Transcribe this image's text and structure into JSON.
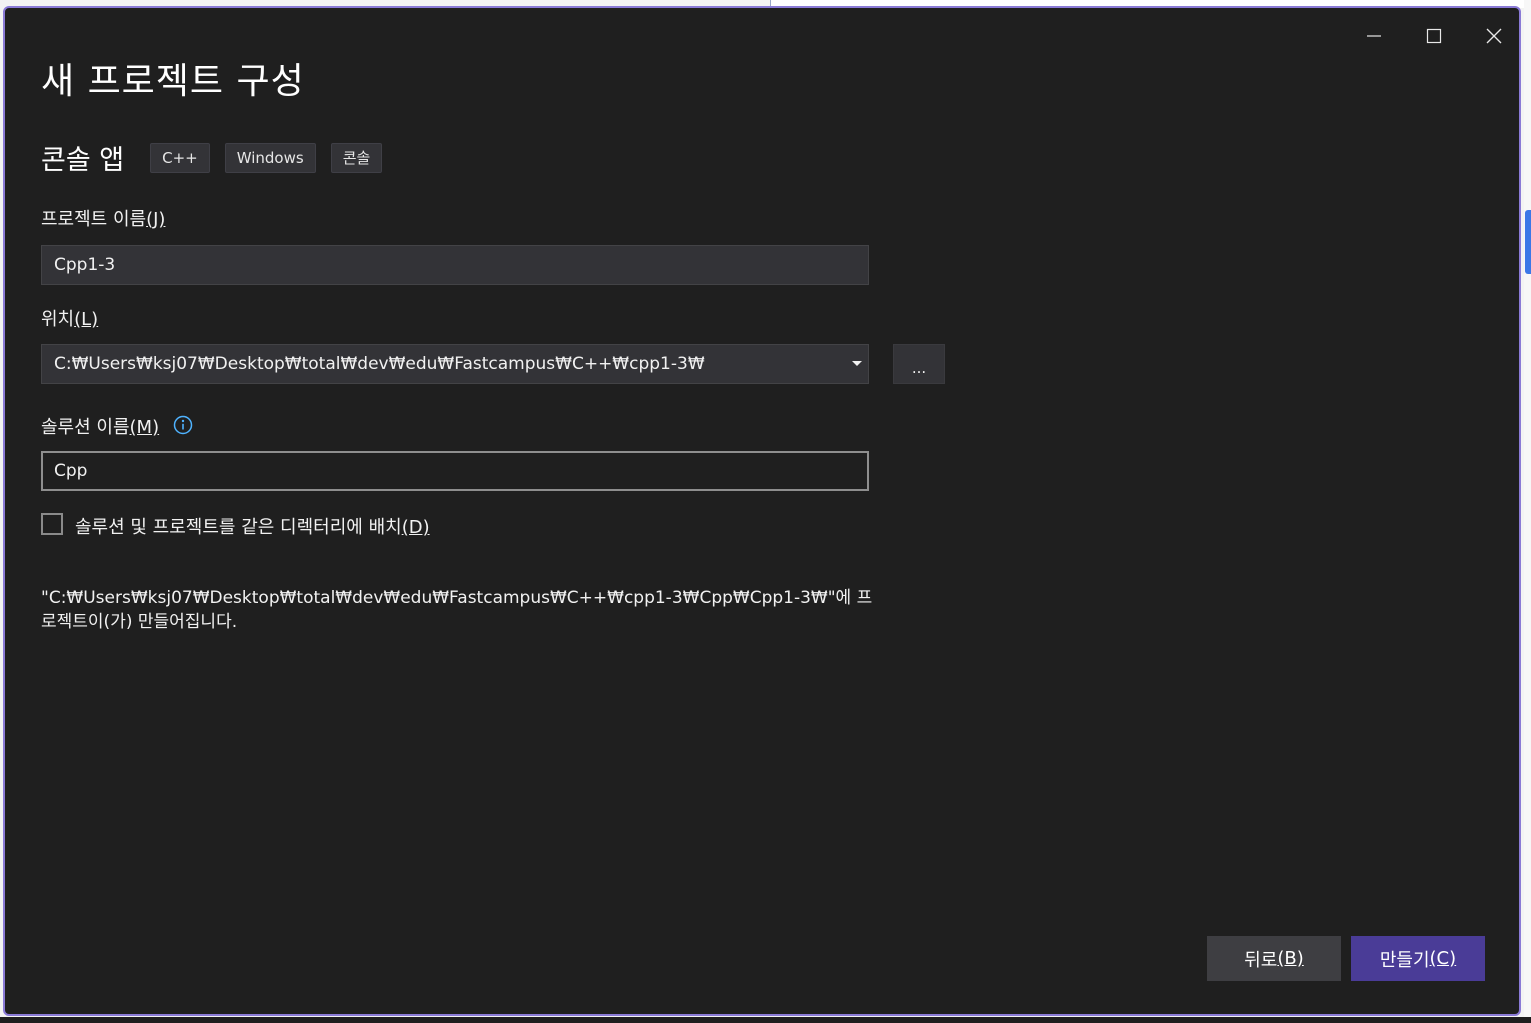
{
  "window": {
    "title": "새 프로젝트 구성",
    "controls": [
      "minimize",
      "maximize",
      "close"
    ]
  },
  "template": {
    "name": "콘솔 앱",
    "tags": [
      "C++",
      "Windows",
      "콘솔"
    ]
  },
  "form": {
    "project_name_label": "프로젝트 이름",
    "project_name_key": "(J)",
    "project_name_value": "Cpp1-3",
    "location_label": "위치",
    "location_key": "(L)",
    "location_value": "C:₩Users₩ksj07₩Desktop₩total₩dev₩edu₩Fastcampus₩C++₩cpp1-3₩",
    "browse_label": "...",
    "solution_name_label": "솔루션 이름",
    "solution_name_key": "(M)",
    "solution_name_value": "Cpp",
    "same_dir_label": "솔루션 및 프로젝트를 같은 디렉터리에 배치",
    "same_dir_key": "(D)",
    "same_dir_checked": false,
    "path_info": "\"C:₩Users₩ksj07₩Desktop₩total₩dev₩edu₩Fastcampus₩C++₩cpp1-3₩Cpp₩Cpp1-3₩\"에 프로젝트이(가) 만들어집니다."
  },
  "buttons": {
    "back_label": "뒤로",
    "back_key": "(B)",
    "create_label": "만들기",
    "create_key": "(C)"
  },
  "colors": {
    "dialog_bg": "#1f1f1f",
    "border_accent": "#8a7ad6",
    "primary_button": "#4a3c97",
    "info_icon": "#4fb3ff"
  }
}
